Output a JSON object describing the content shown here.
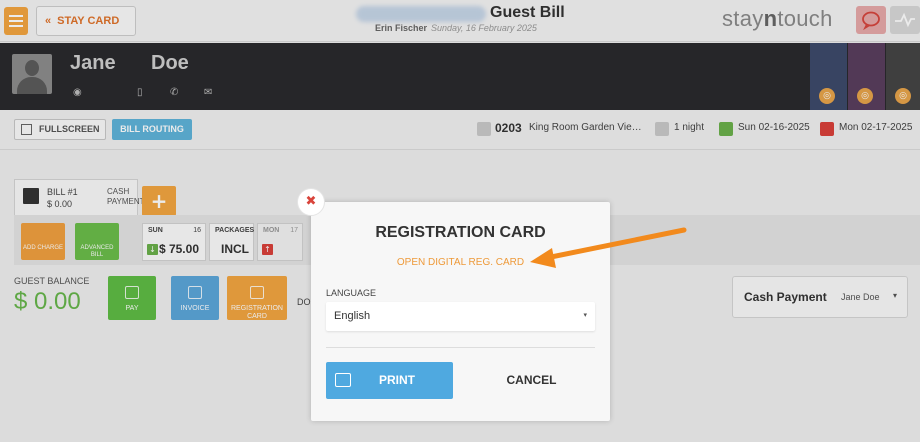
{
  "header": {
    "menu_icon": "hamburger-icon",
    "stay_card_label": "STAY CARD",
    "title": "Guest Bill",
    "user": "Erin Fischer",
    "date": "Sunday, 16 February 2025",
    "brand_pre": "stay",
    "brand_bold": "n",
    "brand_post": "touch"
  },
  "guest": {
    "first_name": "Jane",
    "last_name": "Doe",
    "icons": [
      "location-icon",
      "mobile-icon",
      "phone-icon",
      "email-icon"
    ]
  },
  "toolbar": {
    "fullscreen_label": "FULLSCREEN",
    "routing_label": "BILL ROUTING",
    "room_number": "0203",
    "room_type": "King Room Garden Vie…",
    "nights": "1 night",
    "arrival": "Sun 02-16-2025",
    "departure": "Mon 02-17-2025"
  },
  "bill": {
    "tab_title": "BILL #1",
    "tab_amount": "$ 0.00",
    "tab_payment": "CASH PAYMENT",
    "add_charge": "ADD CHARGE",
    "advanced_bill": "ADVANCED BILL",
    "day1_label": "SUN",
    "day1_num": "16",
    "day1_amount": "$ 75.00",
    "packages_label": "PACKAGES",
    "packages_value": "INCL",
    "day2_label": "MON",
    "day2_num": "17"
  },
  "balance": {
    "label": "GUEST BALANCE",
    "value": "$ 0.00",
    "pay": "PAY",
    "invoice": "INVOICE",
    "registration_card": "REGISTRATION CARD",
    "doc_text": "DOC",
    "payment_method": "Cash Payment",
    "payment_guest": "Jane Doe"
  },
  "modal": {
    "title": "REGISTRATION CARD",
    "link": "OPEN DIGITAL REG. CARD",
    "language_label": "LANGUAGE",
    "language_value": "English",
    "print_label": "PRINT",
    "cancel_label": "CANCEL"
  },
  "colors": {
    "accent_orange": "#f2a541",
    "link_orange": "#ee9a3a",
    "primary_blue": "#4fa9e0",
    "green": "#67b64b",
    "header_dark": "#2a2a2d"
  }
}
